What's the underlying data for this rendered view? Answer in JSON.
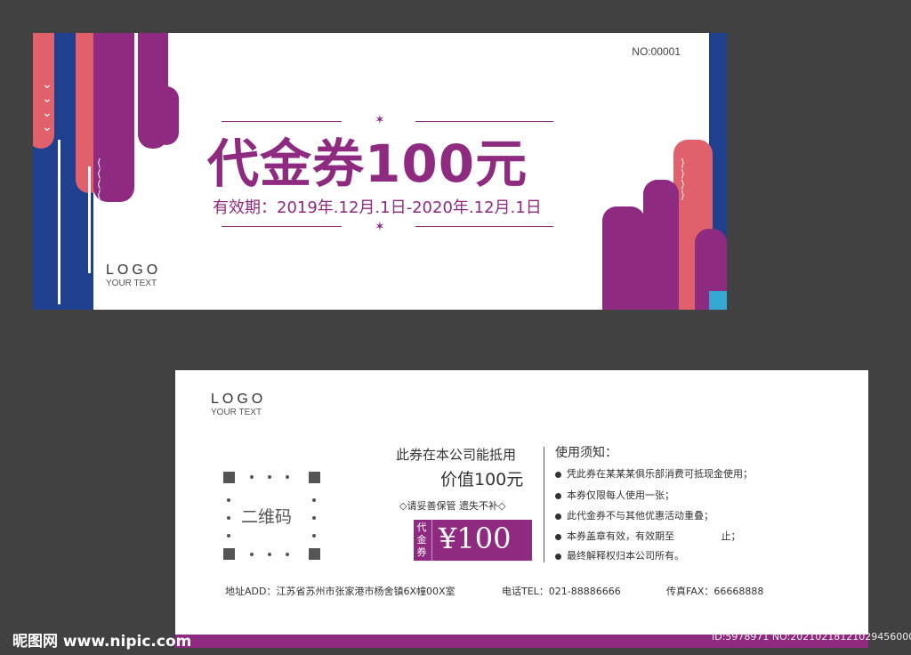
{
  "front": {
    "serial": "NO:00001",
    "title": "代金券100元",
    "validity": "有效期：2019年.12月.1日-2020年.12月.1日",
    "logo": "LOGO",
    "logo_sub": "YOUR TEXT"
  },
  "back": {
    "logo": "LOGO",
    "logo_sub": "YOUR TEXT",
    "qr_label": "二维码",
    "usable_text": "此券在本公司能抵用",
    "value_text": "价值100元",
    "keep_note": "◇请妥善保管 遗失不补◇",
    "badge_label": "代金券",
    "badge_amount": "¥100",
    "rules_title": "使用须知：",
    "rules": [
      "凭此券在某某某俱乐部消费可抵现金使用；",
      "本券仅限每人使用一张；",
      "此代金券不与其他优惠活动重叠；",
      "本券盖章有效，有效期至               止；",
      "最终解释权归本公司所有。"
    ],
    "address": "地址ADD：江苏省苏州市张家港市杨舍镇6X幢00X室",
    "phone": "电话TEL：021-88886666",
    "fax": "传真FAX：66668888"
  },
  "watermark": {
    "site": "昵图网 www.nipic.com",
    "id": "ID:5978971 NO:20210218121029456000"
  },
  "colors": {
    "brand_purple": "#8e2a7f",
    "coral": "#e0606c",
    "navy": "#1f3f8f",
    "background": "#414141"
  }
}
